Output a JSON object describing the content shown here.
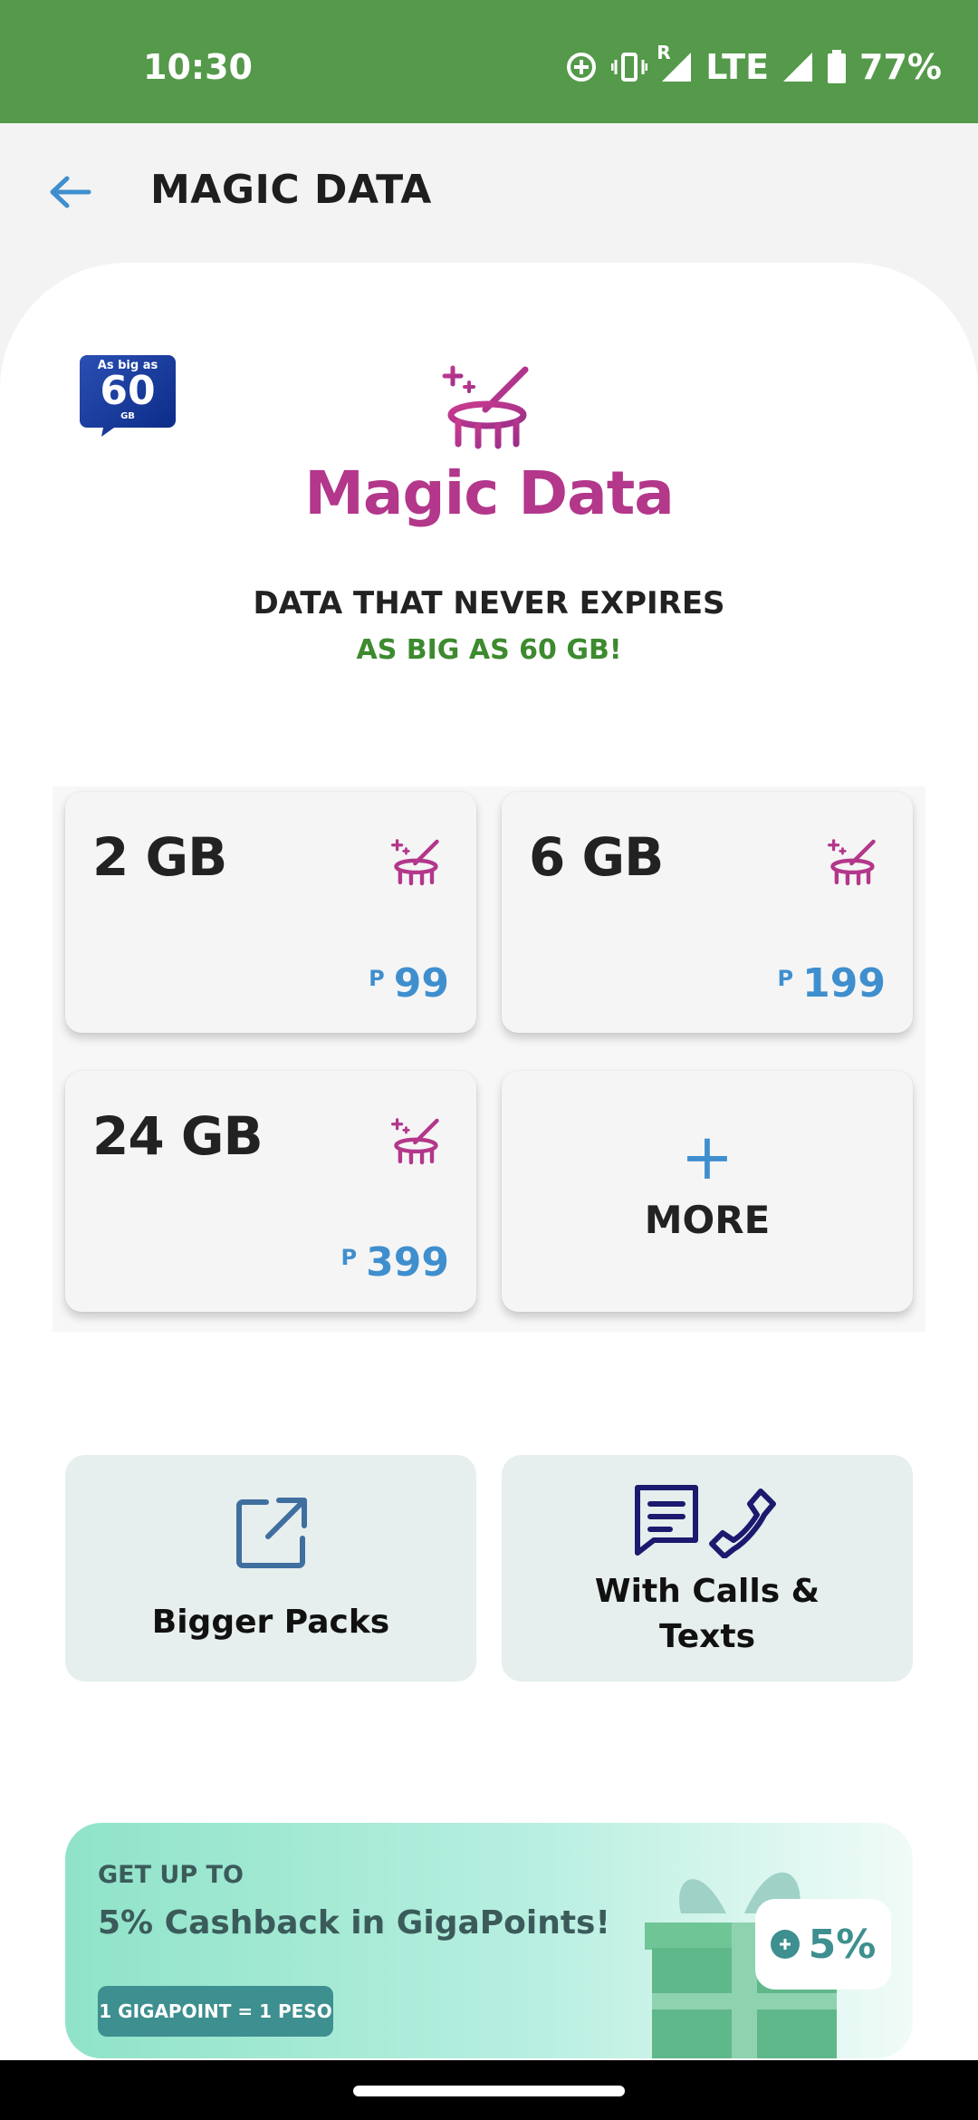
{
  "status_bar": {
    "time": "10:30",
    "network": "LTE",
    "roaming": "R",
    "battery": "77%"
  },
  "app_bar": {
    "title": "MAGIC DATA",
    "back_icon": "arrow-left-icon"
  },
  "hero": {
    "badge": {
      "line1": "As big as",
      "number": "60",
      "unit": "GB"
    },
    "brand_name": "Magic Data",
    "tagline": "DATA THAT NEVER EXPIRES",
    "subtagline": "AS BIG AS 60 GB!"
  },
  "offers": [
    {
      "size": "2 GB",
      "currency": "P",
      "price": "99"
    },
    {
      "size": "6 GB",
      "currency": "P",
      "price": "199"
    },
    {
      "size": "24 GB",
      "currency": "P",
      "price": "399"
    }
  ],
  "more": {
    "icon": "plus-icon",
    "label": "MORE"
  },
  "categories": [
    {
      "label": "Bigger Packs",
      "icon": "external-link-icon"
    },
    {
      "label_line1": "With Calls &",
      "label_line2": "Texts",
      "icon": "message-phone-icon"
    }
  ],
  "cashback": {
    "eyebrow": "GET UP TO",
    "title": "5% Cashback in GigaPoints!",
    "chip": "1 GIGAPOINT = 1 PESO",
    "badge": "5%"
  },
  "colors": {
    "status_bar": "#55994b",
    "brand_magenta": "#b3378a",
    "price_blue": "#3f8fcf",
    "tagline_green": "#3d8a2f",
    "teal": "#3e8f8f"
  }
}
